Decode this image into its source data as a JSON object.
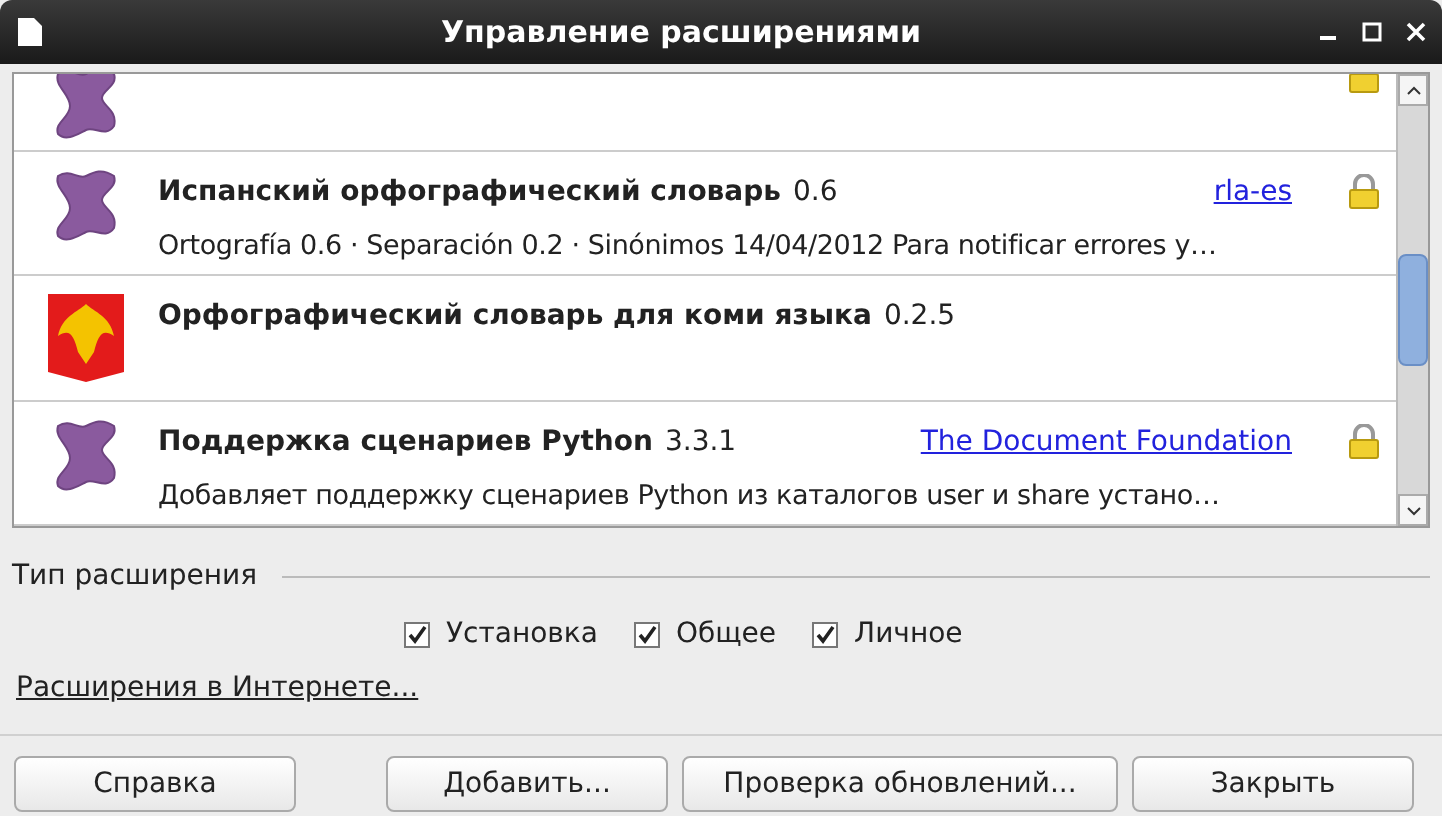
{
  "window": {
    "title": "Управление расширениями"
  },
  "extensions": [
    {
      "kind": "puzzle",
      "locked": true,
      "partial": true
    },
    {
      "kind": "puzzle",
      "locked": true,
      "partial": false,
      "title": "Испанский орфографический словарь",
      "version": "0.6",
      "publisher": "rla-es",
      "description": "Ortografía 0.6 · Separación 0.2 · Sinónimos 14/04/2012   Para notificar errores y…"
    },
    {
      "kind": "emblem",
      "locked": false,
      "partial": false,
      "title": "Орфографический словарь для коми языка",
      "version": "0.2.5"
    },
    {
      "kind": "puzzle",
      "locked": true,
      "partial": false,
      "title": "Поддержка сценариев Python",
      "version": "3.3.1",
      "publisher": "The Document Foundation",
      "description": "Добавляет поддержку сценариев Python из каталогов user и share устано…"
    }
  ],
  "filter": {
    "label": "Тип расширения",
    "options": [
      {
        "label": "Установка",
        "checked": true
      },
      {
        "label": "Общее",
        "checked": true
      },
      {
        "label": "Личное",
        "checked": true
      }
    ]
  },
  "online_link": "Расширения в Интернете...",
  "buttons": [
    "Справка",
    "Добавить...",
    "Проверка обновлений...",
    "Закрыть"
  ]
}
